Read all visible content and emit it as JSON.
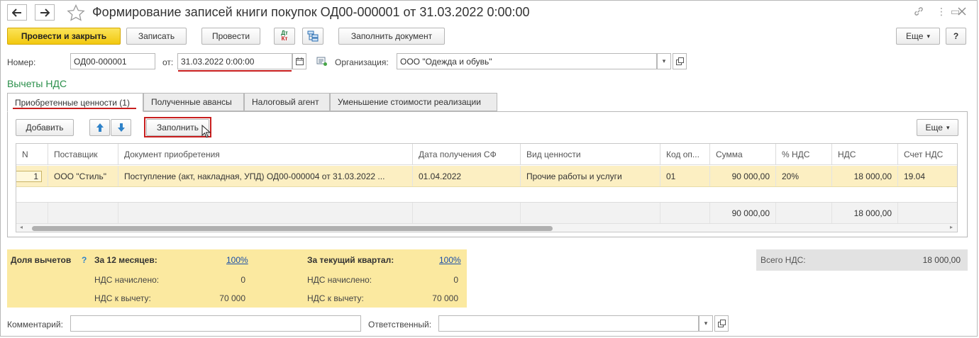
{
  "window": {
    "title": "Формирование записей книги покупок ОД00-000001 от 31.03.2022 0:00:00"
  },
  "toolbar": {
    "post_close": "Провести и закрыть",
    "save": "Записать",
    "post": "Провести",
    "dt_kt_top": "Дт",
    "dt_kt_bottom": "Кт",
    "fill_document": "Заполнить документ",
    "more": "Еще",
    "more_chevron": "▾",
    "help": "?"
  },
  "header": {
    "number_label": "Номер:",
    "number_value": "ОД00-000001",
    "date_label": "от:",
    "date_value": "31.03.2022  0:00:00",
    "org_label": "Организация:",
    "org_value": "ООО \"Одежда и обувь\""
  },
  "section_title": "Вычеты НДС",
  "tabs": [
    {
      "label": "Приобретенные ценности (1)"
    },
    {
      "label": "Полученные авансы"
    },
    {
      "label": "Налоговый агент"
    },
    {
      "label": "Уменьшение стоимости реализации"
    }
  ],
  "table_toolbar": {
    "add": "Добавить",
    "fill": "Заполнить",
    "more": "Еще"
  },
  "table": {
    "columns": [
      "N",
      "Поставщик",
      "Документ приобретения",
      "Дата получения СФ",
      "Вид ценности",
      "Код оп...",
      "Сумма",
      "% НДС",
      "НДС",
      "Счет НДС"
    ],
    "rows": [
      {
        "n": "1",
        "supplier": "ООО \"Стиль\"",
        "document": "Поступление (акт, накладная, УПД) ОД00-000004 от 31.03.2022 ...",
        "sf_date": "01.04.2022",
        "kind": "Прочие работы и услуги",
        "code": "01",
        "sum": "90 000,00",
        "vat_rate": "20%",
        "vat": "18 000,00",
        "vat_account": "19.04"
      }
    ],
    "totals": {
      "sum": "90 000,00",
      "vat": "18 000,00"
    }
  },
  "summary": {
    "share_label": "Доля вычетов",
    "help": "?",
    "period12_label": "За 12 месяцев:",
    "period12_pct": "100%",
    "period12_accrued_label": "НДС начислено:",
    "period12_accrued": "0",
    "period12_deduct_label": "НДС к вычету:",
    "period12_deduct": "70 000",
    "quarter_label": "За текущий квартал:",
    "quarter_pct": "100%",
    "quarter_accrued_label": "НДС начислено:",
    "quarter_accrued": "0",
    "quarter_deduct_label": "НДС к вычету:",
    "quarter_deduct": "70 000"
  },
  "total_vat": {
    "label": "Всего НДС:",
    "value": "18 000,00"
  },
  "footer": {
    "comment_label": "Комментарий:",
    "comment_value": "",
    "responsible_label": "Ответственный:",
    "responsible_value": ""
  },
  "colors": {
    "primary_button": "#f2c80f",
    "section_title": "#2a8f4a",
    "selected_row": "#fcefc2",
    "summary_bg": "#fbe9a0",
    "highlight_red": "#c81e1e",
    "arrow_blue": "#2e82c9"
  }
}
